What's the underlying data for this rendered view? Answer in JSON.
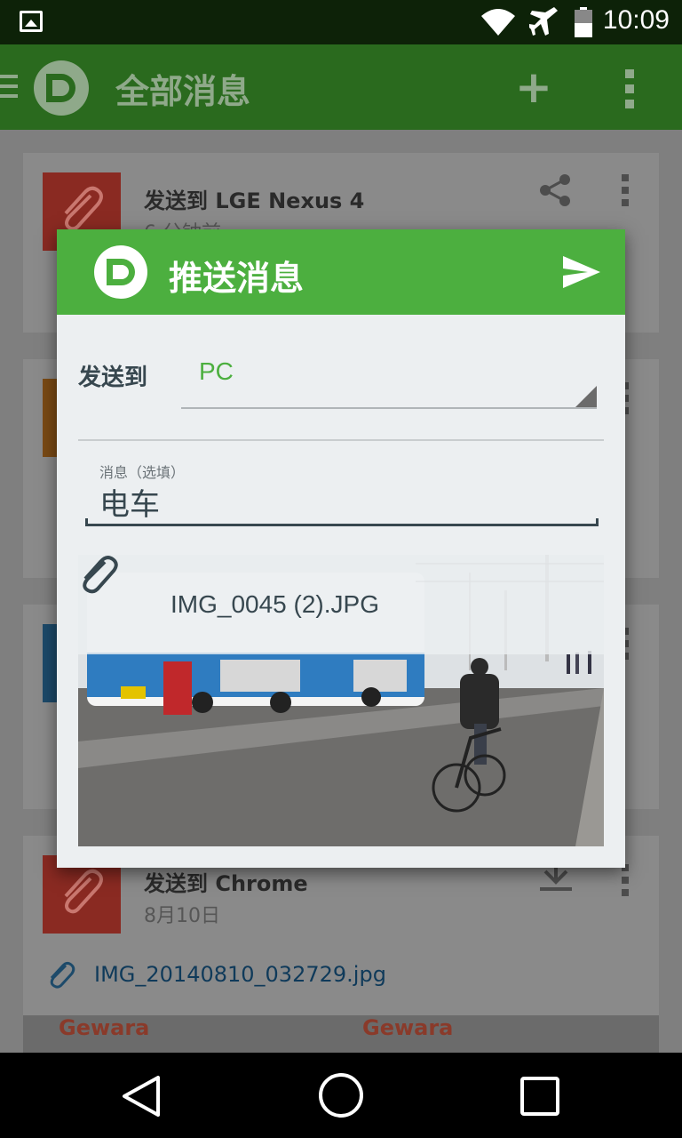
{
  "status_bar": {
    "time": "10:09",
    "icons": [
      "gallery-icon",
      "wifi-icon",
      "airplane-icon",
      "battery-icon"
    ]
  },
  "app_bar": {
    "title": "全部消息",
    "add_icon": "plus-icon",
    "overflow_icon": "more-vert-icon"
  },
  "background_cards": [
    {
      "title": "发送到 LGE Nexus 4",
      "subtitle": "6 分钟前",
      "thumb_color": "#8a2a22",
      "action_icon": "share-icon"
    },
    {
      "title": "",
      "subtitle": "",
      "thumb_color": "#7a4a14"
    },
    {
      "title": "",
      "subtitle": "",
      "thumb_color": "#1d4a6a"
    },
    {
      "title": "发送到 Chrome",
      "subtitle": "8月10日",
      "thumb_color": "#8a2a22",
      "action_icon": "download-icon",
      "file": "IMG_20140810_032729.jpg",
      "photo_text": [
        "Gewara",
        "Gewara"
      ]
    }
  ],
  "dialog": {
    "title": "推送消息",
    "send_icon": "send-icon",
    "send_to_label": "发送到",
    "target_value": "PC",
    "message_hint": "消息（选填）",
    "message_value": "电车",
    "attachment_name": "IMG_0045 (2).JPG",
    "attachment_icon": "paperclip-icon"
  },
  "nav_bar": {
    "back_icon": "back-icon",
    "home_icon": "home-icon",
    "recents_icon": "recents-icon"
  },
  "colors": {
    "primary": "#4caf3f",
    "primary_dark": "#0d2208",
    "dialog_bg": "#eceff1",
    "text_dark": "#37474f"
  }
}
